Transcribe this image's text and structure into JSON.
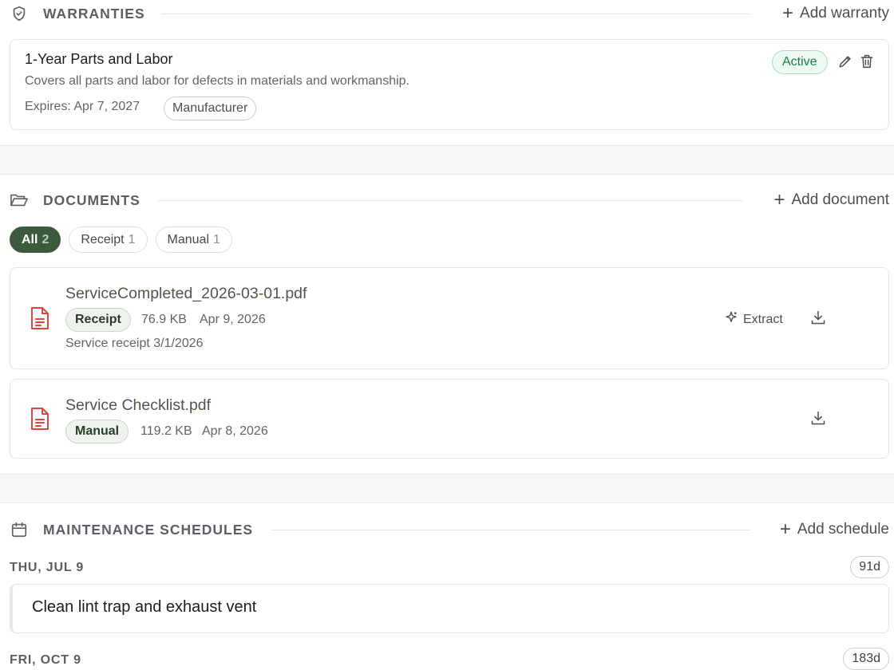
{
  "warranties": {
    "title": "WARRANTIES",
    "add_label": "Add warranty",
    "items": [
      {
        "title": "1-Year Parts and Labor",
        "description": "Covers all parts and labor for defects in materials and workmanship.",
        "expires": "Expires: Apr 7, 2027",
        "tag": "Manufacturer",
        "status": "Active"
      }
    ]
  },
  "documents": {
    "title": "DOCUMENTS",
    "add_label": "Add document",
    "filters": [
      {
        "label": "All",
        "count": "2"
      },
      {
        "label": "Receipt",
        "count": "1"
      },
      {
        "label": "Manual",
        "count": "1"
      }
    ],
    "items": [
      {
        "name": "ServiceCompleted_2026-03-01.pdf",
        "tag": "Receipt",
        "size": "76.9 KB",
        "date": "Apr 9, 2026",
        "note": "Service receipt 3/1/2026",
        "extract_label": "Extract"
      },
      {
        "name": "Service Checklist.pdf",
        "tag": "Manual",
        "size": "119.2 KB",
        "date": "Apr 8, 2026"
      }
    ]
  },
  "maintenance": {
    "title": "MAINTENANCE SCHEDULES",
    "add_label": "Add schedule",
    "groups": [
      {
        "date": "THU, JUL 9",
        "days": "91d",
        "tasks": [
          "Clean lint trap and exhaust vent"
        ]
      },
      {
        "date": "FRI, OCT 9",
        "days": "183d"
      }
    ]
  },
  "colors": {
    "accent": "#3d5a3c",
    "status_active": "#1f7a46",
    "pdf_icon": "#e0453a"
  }
}
